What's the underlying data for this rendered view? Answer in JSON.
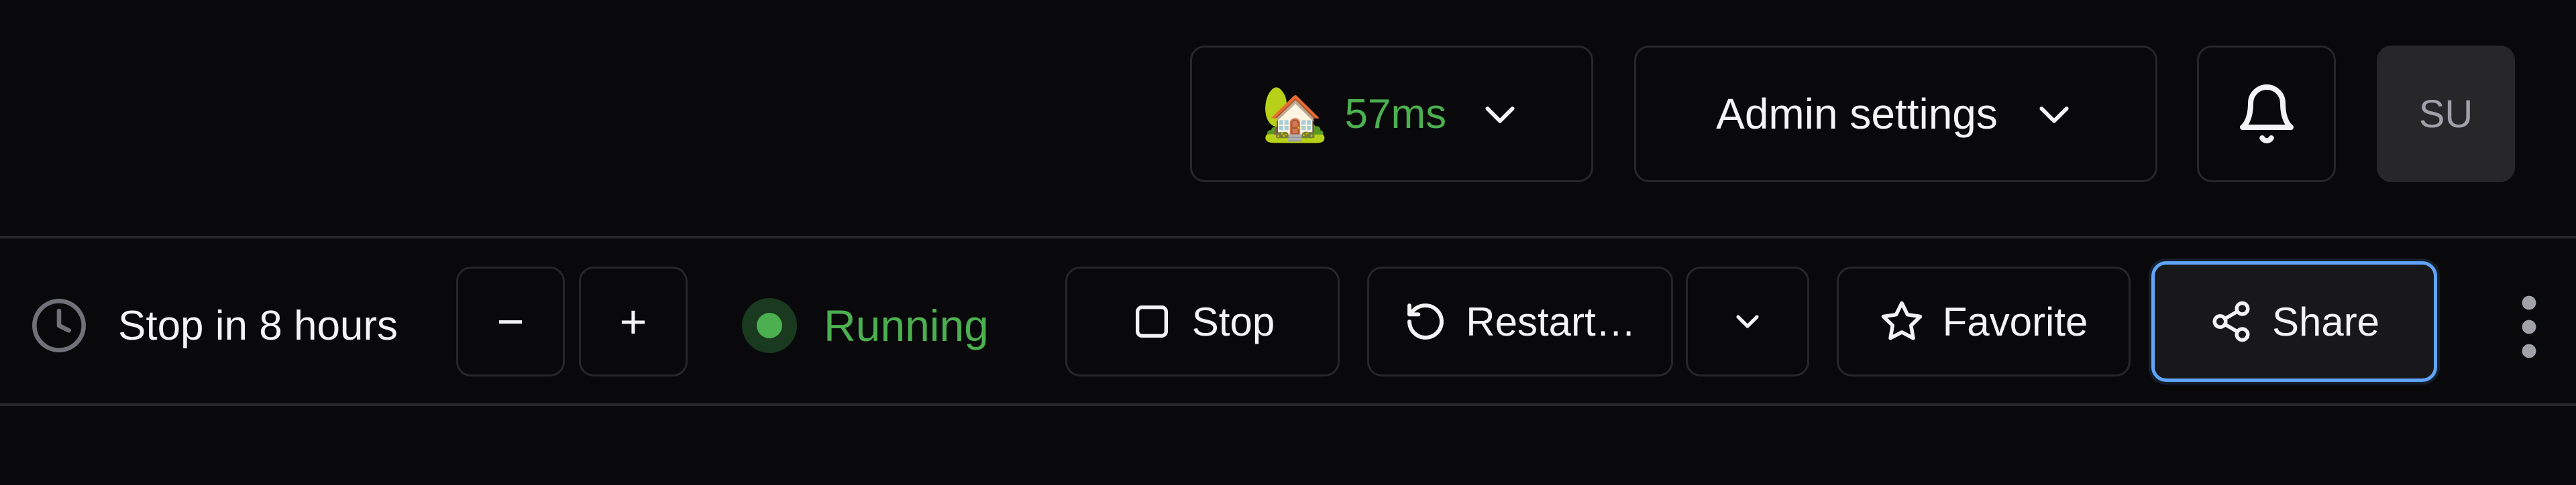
{
  "header": {
    "region": {
      "icon": "house-with-tree-emoji",
      "emoji": "🏡",
      "latency": "57ms",
      "latency_color": "#4caf50"
    },
    "admin_settings_label": "Admin settings",
    "notifications_icon": "bell-icon",
    "avatar_initials": "SU"
  },
  "toolbar": {
    "schedule_text": "Stop in 8 hours",
    "decrease_label": "−",
    "increase_label": "+",
    "status_label": "Running",
    "status_color": "#4caf50",
    "stop_label": "Stop",
    "restart_label": "Restart…",
    "favorite_label": "Favorite",
    "share_label": "Share",
    "share_focus_color": "#60a5fa"
  }
}
